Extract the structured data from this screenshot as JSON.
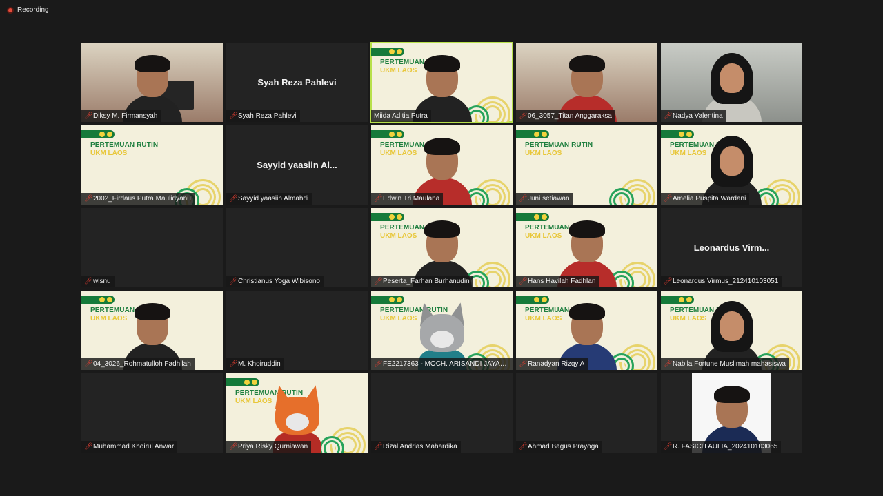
{
  "status": {
    "recording_label": "Recording",
    "recording_icon": "recording-dot-icon",
    "mic_icon": "muted-microphone-icon"
  },
  "branding": {
    "title": "PERTEMUAN RUTIN",
    "subtitle": "UKM LAOS",
    "primary_color": "#157a3a",
    "accent_color": "#e8c73a",
    "cream_color": "#f3f0dc"
  },
  "participants": [
    {
      "name": "Diksy M. Firmansyah",
      "display_name": "",
      "muted": true,
      "active": false
    },
    {
      "name": "Syah Reza Pahlevi",
      "display_name": "Syah Reza Pahlevi",
      "muted": true,
      "active": false
    },
    {
      "name": "Miida Aditia Putra",
      "display_name": "",
      "muted": false,
      "active": true
    },
    {
      "name": "06_3057_Titan Anggaraksa",
      "display_name": "",
      "muted": true,
      "active": false
    },
    {
      "name": "Nadya Valentina",
      "display_name": "",
      "muted": true,
      "active": false
    },
    {
      "name": "2002_Firdaus Putra Maulidyanu",
      "display_name": "",
      "muted": true,
      "active": false
    },
    {
      "name": "Sayyid yaasiin Almahdi",
      "display_name": "Sayyid yaasiin Al...",
      "muted": true,
      "active": false
    },
    {
      "name": "Edwin Tri Maulana",
      "display_name": "",
      "muted": true,
      "active": false
    },
    {
      "name": "Juni setiawan",
      "display_name": "",
      "muted": true,
      "active": false
    },
    {
      "name": "Amelia Puspita Wardani",
      "display_name": "",
      "muted": true,
      "active": false
    },
    {
      "name": "wisnu",
      "display_name": "",
      "muted": true,
      "active": false
    },
    {
      "name": "Christianus Yoga Wibisono",
      "display_name": "",
      "muted": true,
      "active": false
    },
    {
      "name": "Peserta_Farhan Burhanudin",
      "display_name": "",
      "muted": true,
      "active": false
    },
    {
      "name": "Hans Havilah Fadhlan",
      "display_name": "",
      "muted": true,
      "active": false
    },
    {
      "name": "Leonardus Virmus_212410103051",
      "display_name": "Leonardus Virm...",
      "muted": true,
      "active": false
    },
    {
      "name": "04_3026_Rohmatulloh Fadhilah",
      "display_name": "",
      "muted": true,
      "active": false
    },
    {
      "name": "M. Khoiruddin",
      "display_name": "",
      "muted": true,
      "active": false
    },
    {
      "name": "FE2217363 - MOCH. ARISANDI JAYAN...",
      "display_name": "",
      "muted": true,
      "active": false
    },
    {
      "name": "Ranadyan Rizqy A",
      "display_name": "",
      "muted": true,
      "active": false
    },
    {
      "name": "Nabila Fortune Muslimah mahasiswa",
      "display_name": "",
      "muted": true,
      "active": false
    },
    {
      "name": "Muhammad Khoirul Anwar",
      "display_name": "",
      "muted": true,
      "active": false
    },
    {
      "name": "Priya Risky Qurniawan",
      "display_name": "",
      "muted": true,
      "active": false
    },
    {
      "name": "Rizal Andrias Mahardika",
      "display_name": "",
      "muted": true,
      "active": false
    },
    {
      "name": "Ahmad Bagus Prayoga",
      "display_name": "",
      "muted": true,
      "active": false
    },
    {
      "name": "R. FASICH AULIA_202410103065",
      "display_name": "",
      "muted": true,
      "active": false
    }
  ]
}
